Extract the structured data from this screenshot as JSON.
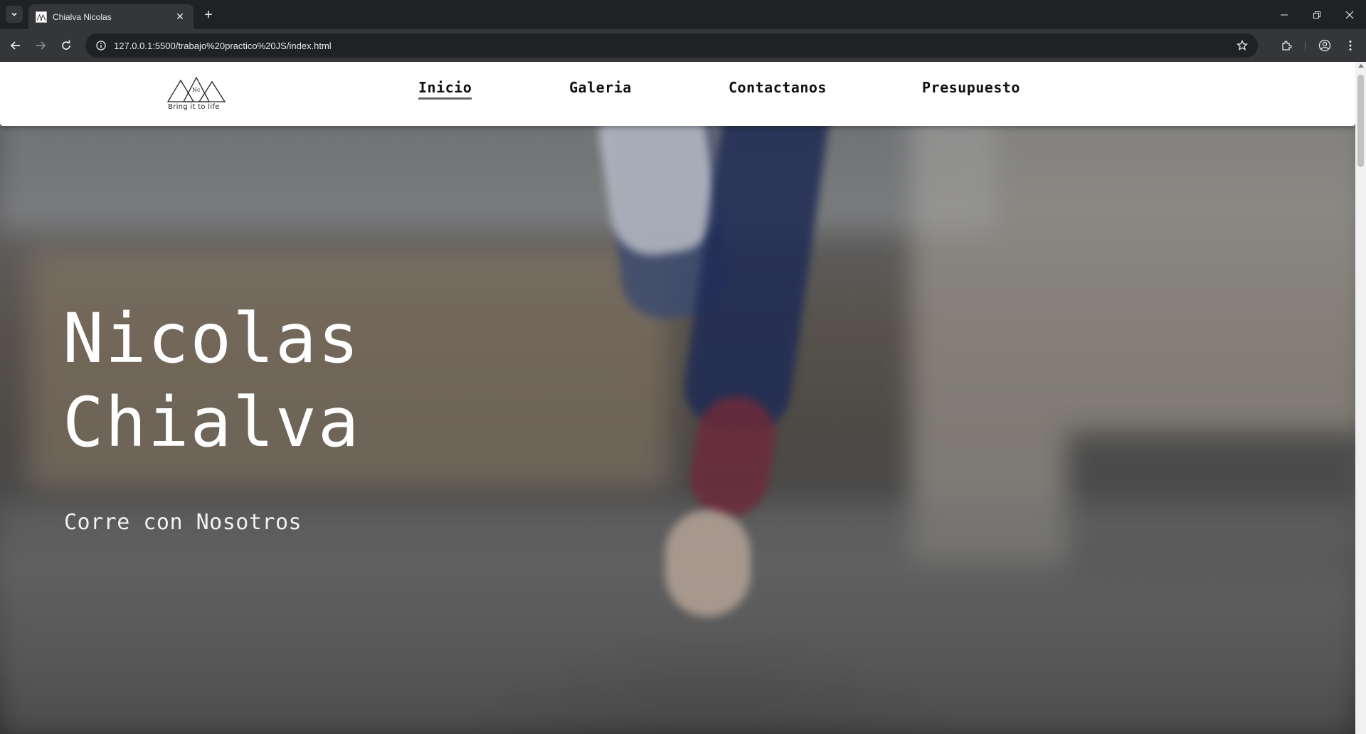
{
  "browser": {
    "tab_title": "Chialva Nicolas",
    "url": "127.0.0.1:5500/trabajo%20practico%20JS/index.html",
    "icons": [
      "tab-search-icon",
      "favicon-icon",
      "close-icon",
      "plus-icon",
      "minimize-icon",
      "maximize-icon",
      "close-window-icon",
      "back-arrow-icon",
      "forward-arrow-icon",
      "reload-icon",
      "info-icon",
      "star-icon",
      "extensions-icon",
      "profile-icon",
      "kebab-menu-icon"
    ]
  },
  "site": {
    "logo": {
      "monogram": "Nc",
      "tagline": "Bring it to life"
    },
    "nav": [
      {
        "label": "Inicio",
        "active": true
      },
      {
        "label": "Galeria",
        "active": false
      },
      {
        "label": "Contactanos",
        "active": false
      },
      {
        "label": "Presupuesto",
        "active": false
      }
    ],
    "hero": {
      "title_line1": "Nicolas",
      "title_line2": "Chialva",
      "subtitle": "Corre con Nosotros"
    }
  },
  "colors": {
    "chrome_dark": "#202124",
    "chrome_toolbar": "#35363a",
    "navbar_bg": "#ffffff",
    "hero_text": "#ffffff"
  }
}
